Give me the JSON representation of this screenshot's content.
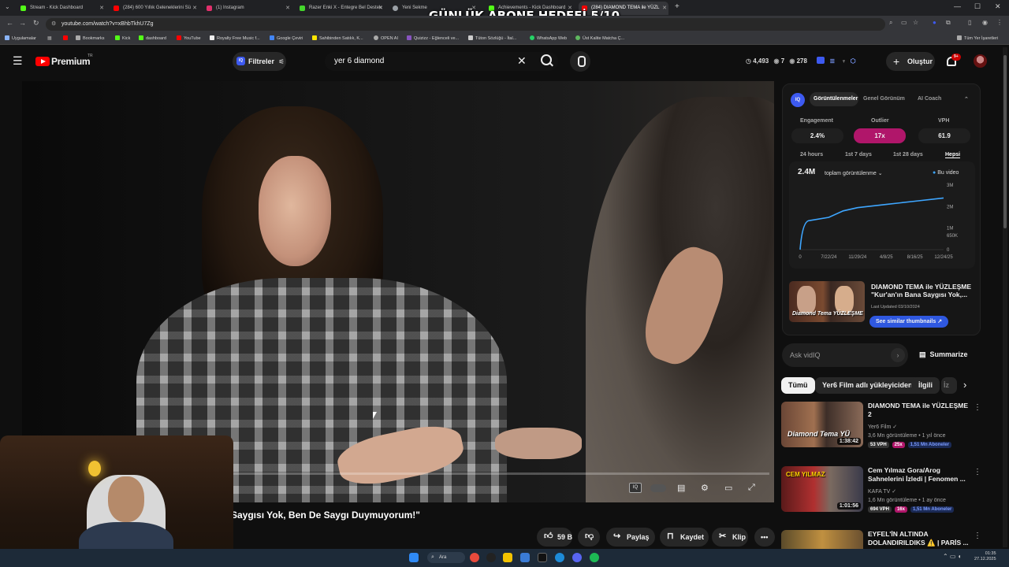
{
  "overlay": {
    "title": "GÜNLÜK ABONE HEDEFİ 5/10"
  },
  "browser": {
    "tabs": [
      {
        "label": "Stream - Kick Dashboard",
        "favicon_color": "#53fc18"
      },
      {
        "label": "(284) 600 Yıllık Geleneklerini Sü",
        "favicon_color": "#ff0000"
      },
      {
        "label": "(1) Instagram",
        "favicon_color": "#e1306c"
      },
      {
        "label": "Razer Enki X - Entegre Bel Destek",
        "favicon_color": "#44d62c"
      },
      {
        "label": "Yeni Sekme",
        "favicon_color": "#9aa0a6"
      },
      {
        "label": "Achievements - Kick Dashboard",
        "favicon_color": "#53fc18"
      },
      {
        "label": "(284) DIAMOND TEMA ile YÜZL",
        "favicon_color": "#ff0000"
      }
    ],
    "url": "youtube.com/watch?v=xBhbTkhU7Zg",
    "bookmarks": [
      "Uygulamalar",
      "Bookmarks",
      "Kick",
      "dashboard",
      "YouTube",
      "Royalty Free Music f...",
      "Google Çeviri",
      "Sahibinden Satılık, K...",
      "OPEN AI",
      "Quizizz - Eğlenceli ve...",
      "Tüton Sözlüğü - İtal...",
      "WhatsApp Web",
      "Üst Kalite Matcha Ç..."
    ],
    "all_bookmarks": "Tüm Yer İşaretleri"
  },
  "masthead": {
    "logo": "Premium",
    "logo_region": "TR",
    "filters_label": "Filtreler",
    "search_value": "yer 6 diamond",
    "stats": {
      "a": "4,493",
      "b": "7",
      "c": "278"
    },
    "create_label": "Oluştur",
    "notif_badge": "9+"
  },
  "video": {
    "title": "Saygısı Yok, Ben De Saygı Duymuyorum!\"",
    "likes": "59 B",
    "share": "Paylaş",
    "save": "Kaydet",
    "clip": "Klip"
  },
  "vidiq": {
    "tabs": [
      "Görüntülenmeler",
      "Genel Görünüm",
      "AI Coach"
    ],
    "metrics": [
      {
        "label": "Engagement",
        "value": "2.4%"
      },
      {
        "label": "Outlier",
        "value": "17x"
      },
      {
        "label": "VPH",
        "value": "61.9"
      }
    ],
    "ranges": [
      "24 hours",
      "1st 7 days",
      "1st 28 days",
      "Hepsi"
    ],
    "total_views": "2.4M",
    "views_dropdown": "toplam görüntülenme",
    "legend": "Bu video",
    "related_title": "DIAMOND TEMA ile YÜZLEŞME \"Kur'an'ın Bana Saygısı Yok,...",
    "last_updated": "Last Updated 03/10/2024",
    "similar_btn": "See similar thumbnails",
    "thumb_text": "Diamond Tema YÜZLEŞME"
  },
  "chart_data": {
    "type": "line",
    "title": "",
    "xlabel": "",
    "ylabel": "",
    "x_ticks": [
      "0",
      "7/22/24",
      "11/29/24",
      "4/8/25",
      "8/16/25",
      "12/24/25"
    ],
    "y_ticks": [
      "0",
      "650K",
      "1M",
      "2M",
      "3M"
    ],
    "series": [
      {
        "name": "Bu video",
        "color": "#3ea6ff",
        "x": [
          "0",
          "7/22/24",
          "9/10/24",
          "11/29/24",
          "4/8/25",
          "8/16/25",
          "12/24/25"
        ],
        "values": [
          0,
          1500000,
          1800000,
          1950000,
          2100000,
          2250000,
          2400000
        ]
      }
    ],
    "ylim": [
      0,
      3000000
    ],
    "grid": false,
    "legend": "top-right"
  },
  "sidebar": {
    "ask_placeholder": "Ask vidIQ",
    "summarize": "Summarize",
    "chips": [
      "Tümü",
      "Yer6 Film adlı yükleyiciden",
      "İlgili",
      "İz"
    ],
    "recommendations": [
      {
        "title": "DIAMOND TEMA ile YÜZLEŞME 2",
        "channel": "Yer6 Film",
        "views": "3,6 Mn görüntüleme • 1 yıl önce",
        "duration": "1:38:42",
        "vph": "53 VPH",
        "outlier": "25x",
        "subs": "1,51 Mn Aboneler",
        "thumb_text": "Diamond Tema YÜ"
      },
      {
        "title": "Cem Yılmaz Gora/Arog Sahnelerini İzledi | Fenomen ...",
        "channel": "KAFA TV",
        "views": "1,6 Mn görüntüleme • 1 ay önce",
        "duration": "1:01:56",
        "vph": "694 VPH",
        "outlier": "16x",
        "subs": "1,51 Mn Aboneler",
        "thumb_text": "CEM YILMAZ"
      },
      {
        "title": "EYFEL'İN ALTINDA DOLANDIRILDIKS ⚠️ | PARİS ...",
        "channel": "",
        "views": "",
        "duration": "",
        "vph": "",
        "outlier": "",
        "subs": "",
        "thumb_text": ""
      }
    ]
  },
  "taskbar": {
    "search": "Ara",
    "time": "01:35",
    "date": "27.12.2025"
  }
}
